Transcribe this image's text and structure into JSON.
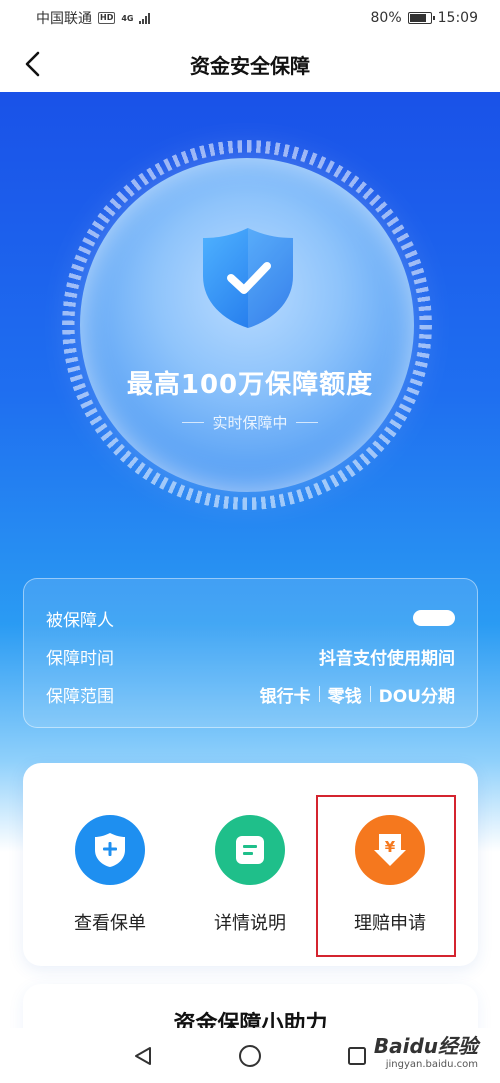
{
  "status_bar": {
    "carrier": "中国联通",
    "hd": "HD",
    "network": "4G",
    "battery": "80%",
    "battery_level": 0.8,
    "time": "15:09"
  },
  "nav": {
    "title": "资金安全保障"
  },
  "hero": {
    "title": "最高100万保障额度",
    "subtitle": "实时保障中"
  },
  "info": {
    "rows": [
      {
        "label": "被保障人",
        "value": ""
      },
      {
        "label": "保障时间",
        "value": "抖音支付使用期间"
      },
      {
        "label": "保障范围",
        "value_parts": [
          "银行卡",
          "零钱",
          "DOU分期"
        ]
      }
    ]
  },
  "actions": [
    {
      "label": "查看保单",
      "icon": "shield-plus-icon",
      "color": "#1e8ff0"
    },
    {
      "label": "详情说明",
      "icon": "document-icon",
      "color": "#1fbf8a"
    },
    {
      "label": "理赔申请",
      "icon": "yuan-download-icon",
      "color": "#f5781e"
    }
  ],
  "next_card": {
    "title": "资金保障小助力"
  },
  "watermark": {
    "main": "Baidu经验",
    "sub": "jingyan.baidu.com"
  }
}
